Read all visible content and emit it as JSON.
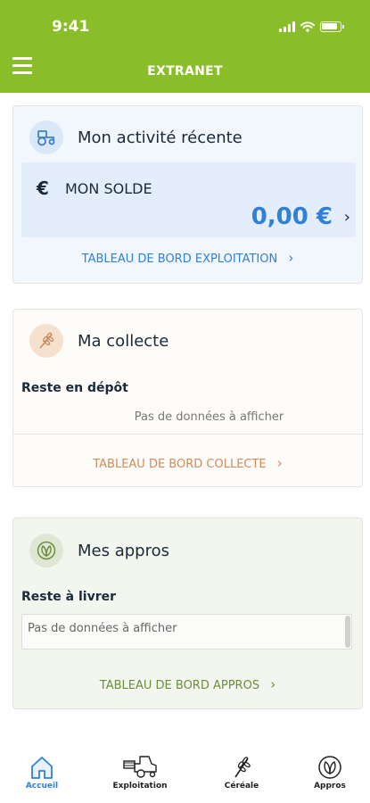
{
  "status_bar": {
    "time": "9:41"
  },
  "header": {
    "title": "EXTRANET"
  },
  "activity": {
    "title": "Mon activité récente",
    "balance_label": "MON SOLDE",
    "currency_symbol": "€",
    "balance_value": "0,00 €",
    "link": "TABLEAU DE BORD EXPLOITATION",
    "link_color": "#2f80d8",
    "bg_color": "#f2f7fd"
  },
  "collecte": {
    "title": "Ma collecte",
    "section_label": "Reste en dépôt",
    "empty_text": "Pas de données à afficher",
    "link": "TABLEAU DE BORD COLLECTE",
    "link_color": "#cf8a5a",
    "bg_color": "#fefcf8"
  },
  "appros": {
    "title": "Mes appros",
    "section_label": "Reste à livrer",
    "empty_text": "Pas de données à afficher",
    "link": "TABLEAU DE BORD APPROS",
    "link_color": "#6b8f3a",
    "bg_color": "#f3f5ef"
  },
  "tabs": [
    {
      "label": "Accueil",
      "icon": "home-icon",
      "active": true
    },
    {
      "label": "Exploitation",
      "icon": "harvester-icon",
      "active": false
    },
    {
      "label": "Céréale",
      "icon": "wheat-icon",
      "active": false
    },
    {
      "label": "Appros",
      "icon": "leaf-icon",
      "active": false
    }
  ]
}
